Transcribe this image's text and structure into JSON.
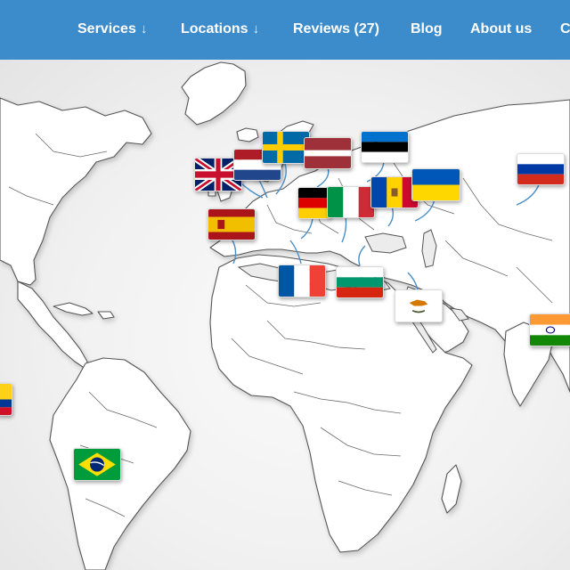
{
  "nav": {
    "items": [
      {
        "label": "Services",
        "has_dropdown": true,
        "icon": "arrow-down-icon"
      },
      {
        "label": "Locations",
        "has_dropdown": true,
        "icon": "arrow-down-icon"
      },
      {
        "label": "Reviews (27)",
        "has_dropdown": false
      },
      {
        "label": "Blog",
        "has_dropdown": false
      },
      {
        "label": "About us",
        "has_dropdown": false
      },
      {
        "label": "C",
        "has_dropdown": false
      }
    ],
    "dropdown_arrow": "↓",
    "background_color": "#3c8bca",
    "text_color": "#ffffff"
  },
  "map": {
    "land_color": "#ffffff",
    "outline_color": "#555555",
    "connector_color": "#4a8ec6",
    "flags": [
      "united-kingdom",
      "netherlands",
      "sweden",
      "latvia",
      "estonia",
      "russia",
      "germany",
      "italy",
      "moldova",
      "ukraine",
      "spain",
      "france",
      "bulgaria",
      "cyprus",
      "india",
      "colombia",
      "brazil"
    ]
  }
}
